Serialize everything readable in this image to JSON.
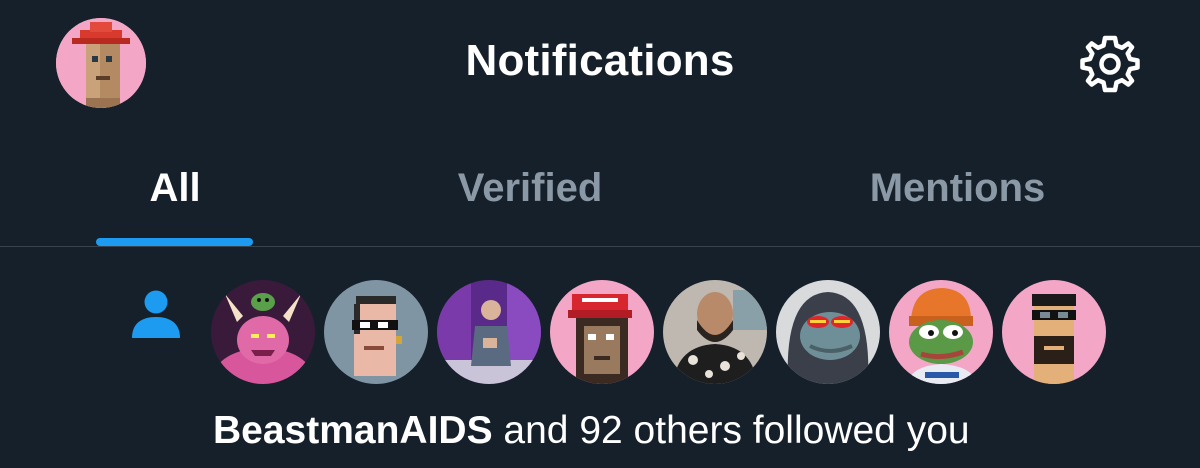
{
  "header": {
    "title": "Notifications",
    "profile_icon": "user-avatar",
    "settings_icon": "gear-icon"
  },
  "tabs": [
    {
      "label": "All",
      "active": true
    },
    {
      "label": "Verified",
      "active": false
    },
    {
      "label": "Mentions",
      "active": false
    }
  ],
  "notification": {
    "type_icon": "person-icon",
    "follower_avatars": [
      "horned-monster-avatar",
      "pixel-punk-sunglasses-avatar",
      "photo-person-purple-avatar",
      "pixel-punk-red-cap-avatar",
      "photo-bearded-man-avatar",
      "hooded-pepe-red-eyes-avatar",
      "pepe-orange-beanie-avatar",
      "pixel-punk-headband-avatar"
    ],
    "username": "BeastmanAIDS",
    "message": " and 92 others followed you"
  },
  "colors": {
    "background": "#15202b",
    "accent": "#1d9bf0",
    "muted_text": "#8b98a5",
    "divider": "#38444d"
  }
}
